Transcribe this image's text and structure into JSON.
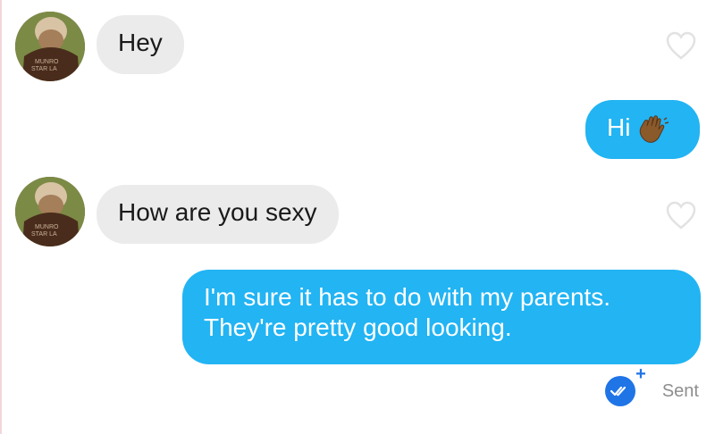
{
  "conversation": {
    "messages": [
      {
        "sender": "them",
        "text": "Hey"
      },
      {
        "sender": "me",
        "text": "Hi",
        "emoji": "waving-hand-icon"
      },
      {
        "sender": "them",
        "text": "How are you sexy"
      },
      {
        "sender": "me",
        "text": "I'm sure it has to do with my parents. They're pretty good looking."
      }
    ],
    "status": {
      "label": "Sent",
      "badge_icon": "double-check-icon",
      "plus": "+"
    }
  },
  "colors": {
    "incoming_bubble": "#ebebeb",
    "outgoing_bubble": "#22b4f3",
    "status_badge": "#1f74e6",
    "heart_outline": "#e2e2e2"
  }
}
